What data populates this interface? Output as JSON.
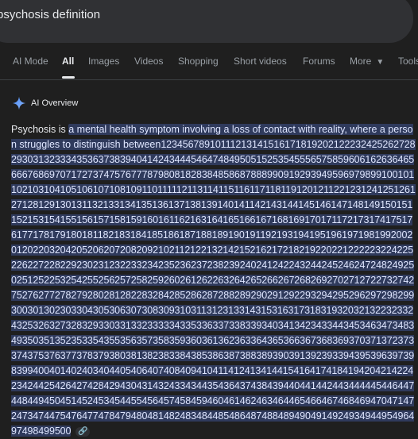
{
  "search": {
    "query": "psychosis definition"
  },
  "tabs": [
    {
      "label": "AI Mode"
    },
    {
      "label": "All"
    },
    {
      "label": "Images"
    },
    {
      "label": "Videos"
    },
    {
      "label": "Shopping"
    },
    {
      "label": "Short videos"
    },
    {
      "label": "Forums"
    },
    {
      "label": "More"
    },
    {
      "label": "Tools"
    }
  ],
  "ai_overview": {
    "title": "AI Overview",
    "term": "Psychosis is ",
    "definition": "a mental health symptom involving a loss of contact with reality, where a person struggles to distinguish between",
    "numbers": "123456789101112131415161718192021222324252627282930313233343536373839404142434445464748495051525354555657585960616263646566676869707172737475767778798081828384858687888990919293949596979899100101102103104105106107108109110111112113114115116117118119120121122123124125126127128129130131132133134135136137138139140141142143144145146147148149150151152153154155156157158159160161162163164165166167168169170171172173174175176177178179180181182183184185186187188189190191192193194195196197198199200201202203204205206207208209210211212213214215216217218219220221222223224225226227228229230231232233234235236237238239240241242243244245246247248249250251252253254255256257258259260261262263264265266267268269270271272273274275276277278279280281282283284285286287288289290291292293294295296297298299300301302303304305306307308309310311312313314315316317318319320321322323324325326327328329330331332333334335336337338339340341342343344345346347348349350351352353354355356357358359360361362363364365366367368369370371372373374375376377378379380381382383384385386387388389390391392393394395396397398399400401402403404405406407408409410411412413414415416417418419420421422423424425426427428429430431432433434435436437438439440441442443444445446447448449450451452453454455456457458459460461462463464465466467468469470471472473474475476477478479480481482483484485486487488489490491492493494495496497498499500"
  },
  "colors": {
    "background": "#1f1f1f",
    "highlight": "#2f3a5c",
    "gemini_blue": "#4c8df6"
  },
  "icons": {
    "ai_overview": "gemini-sparkle-icon",
    "link": "link-icon",
    "more": "chevron-down-icon"
  }
}
